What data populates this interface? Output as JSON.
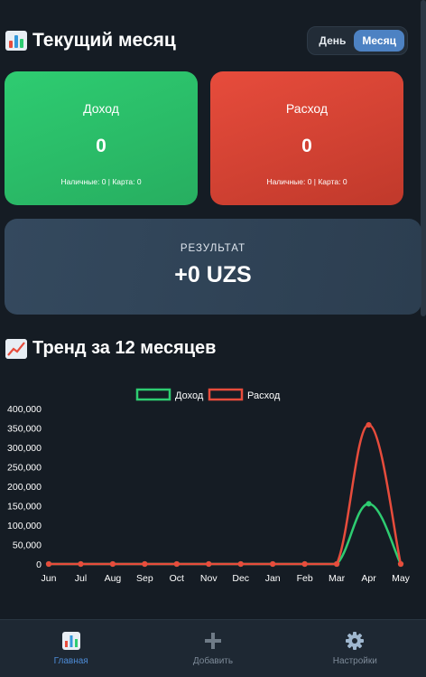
{
  "header": {
    "title": "Текущий месяц",
    "title_icon": "bar-chart-icon",
    "period_toggle": {
      "options": [
        "День",
        "Месяц"
      ],
      "selected": "Месяц"
    }
  },
  "income_card": {
    "label": "Доход",
    "value": "0",
    "breakdown": "Наличные: 0 | Карта: 0",
    "color": "#2ecc71"
  },
  "expense_card": {
    "label": "Расход",
    "value": "0",
    "breakdown": "Наличные: 0 | Карта: 0",
    "color": "#e74c3c"
  },
  "result": {
    "label": "РЕЗУЛЬТАТ",
    "value": "+0 UZS"
  },
  "trend": {
    "title": "Тренд за 12 месяцев",
    "title_icon": "trend-chart-icon"
  },
  "chart_data": {
    "type": "line",
    "x": [
      "Jun",
      "Jul",
      "Aug",
      "Sep",
      "Oct",
      "Nov",
      "Dec",
      "Jan",
      "Feb",
      "Mar",
      "Apr",
      "May"
    ],
    "series": [
      {
        "name": "Доход",
        "color": "#2ecc71",
        "values": [
          0,
          0,
          0,
          0,
          0,
          0,
          0,
          0,
          0,
          0,
          155000,
          0
        ]
      },
      {
        "name": "Расход",
        "color": "#e74c3c",
        "values": [
          0,
          0,
          0,
          0,
          0,
          0,
          0,
          0,
          0,
          0,
          358000,
          0
        ]
      }
    ],
    "ylim": [
      0,
      400000
    ],
    "yticks": [
      "0",
      "50,000",
      "100,000",
      "150,000",
      "200,000",
      "250,000",
      "300,000",
      "350,000",
      "400,000"
    ],
    "legend": "top-center",
    "grid": false
  },
  "bottom_nav": {
    "items": [
      {
        "label": "Главная",
        "icon": "bar-chart-icon",
        "active": true
      },
      {
        "label": "Добавить",
        "icon": "plus-icon",
        "active": false
      },
      {
        "label": "Настройки",
        "icon": "gear-icon",
        "active": false
      }
    ]
  }
}
